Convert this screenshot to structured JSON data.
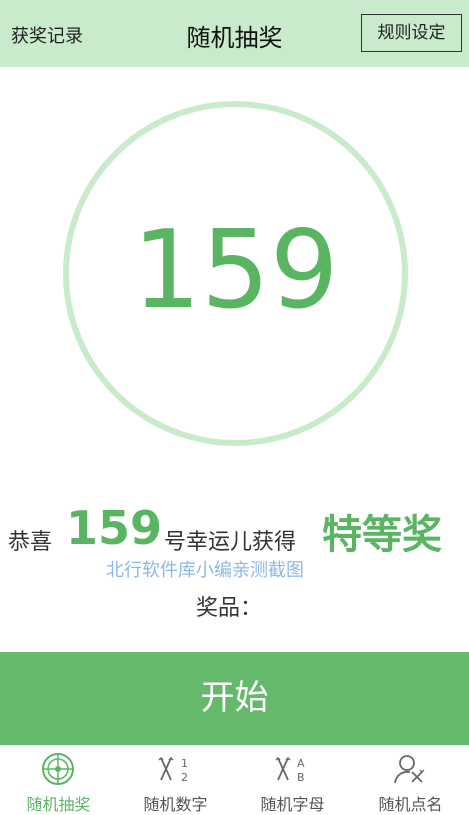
{
  "header": {
    "history_label": "获奖记录",
    "title": "随机抽奖",
    "rules_label": "规则设定"
  },
  "display": {
    "number": "159"
  },
  "result": {
    "congrats": "恭喜",
    "number": "159",
    "suffix": "号幸运儿获得",
    "prize_level": "特等奖"
  },
  "watermark_text": "北行软件库小编亲测截图",
  "prize_label": "奖品：",
  "start_button": {
    "label": "开始"
  },
  "tabs": [
    {
      "label": "随机抽奖",
      "icon": "wheel-icon",
      "active": true
    },
    {
      "label": "随机数字",
      "icon": "random-number-icon",
      "active": false
    },
    {
      "label": "随机字母",
      "icon": "random-letter-icon",
      "active": false
    },
    {
      "label": "随机点名",
      "icon": "roll-call-icon",
      "active": false
    }
  ],
  "colors": {
    "accent": "#5ab563",
    "header_bg": "#c9ebcb",
    "button_bg": "#64ba6a",
    "link_blue": "#8cb8e8"
  }
}
